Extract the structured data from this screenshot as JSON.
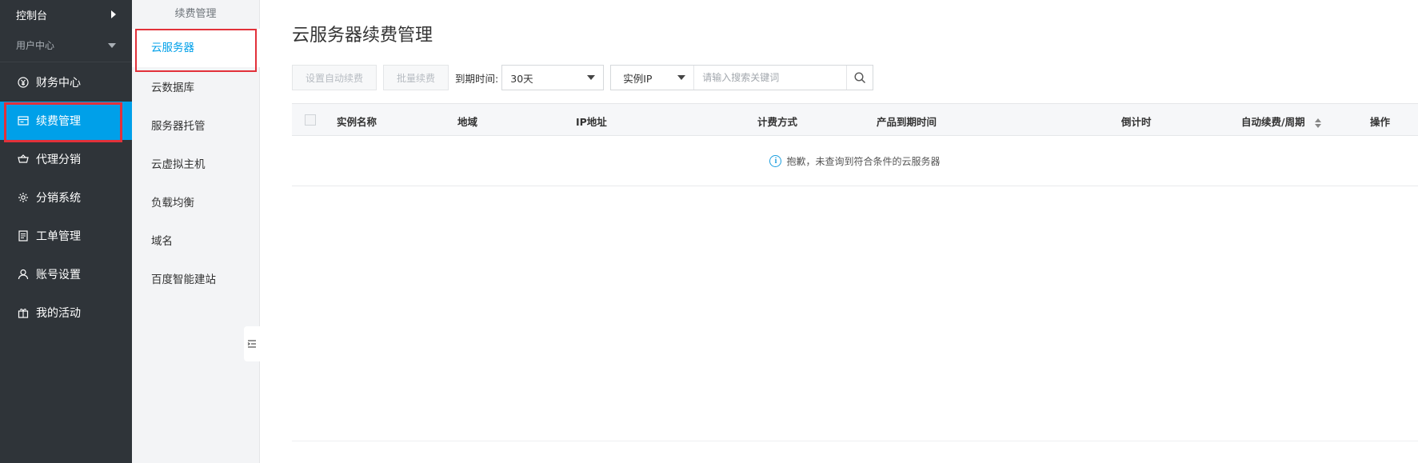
{
  "sidebar": {
    "console": "控制台",
    "user_center": "用户中心",
    "items": [
      {
        "label": "财务中心",
        "icon": "yen-coin-icon"
      },
      {
        "label": "续费管理",
        "icon": "renew-card-icon"
      },
      {
        "label": "代理分销",
        "icon": "basket-icon"
      },
      {
        "label": "分销系统",
        "icon": "gear-icon"
      },
      {
        "label": "工单管理",
        "icon": "document-icon"
      },
      {
        "label": "账号设置",
        "icon": "user-icon"
      },
      {
        "label": "我的活动",
        "icon": "gift-icon"
      }
    ]
  },
  "subpanel": {
    "title": "续费管理",
    "items": [
      {
        "label": "云服务器"
      },
      {
        "label": "云数据库"
      },
      {
        "label": "服务器托管"
      },
      {
        "label": "云虚拟主机"
      },
      {
        "label": "负载均衡"
      },
      {
        "label": "域名"
      },
      {
        "label": "百度智能建站"
      }
    ]
  },
  "main": {
    "title": "云服务器续费管理",
    "toolbar": {
      "auto_renew_btn": "设置自动续费",
      "batch_renew_btn": "批量续费",
      "expire_label": "到期时间:",
      "expire_value": "30天",
      "search_type": "实例IP",
      "search_placeholder": "请输入搜索关键词"
    },
    "table": {
      "columns": [
        "实例名称",
        "地域",
        "IP地址",
        "计费方式",
        "产品到期时间",
        "倒计时",
        "自动续费/周期",
        "操作"
      ],
      "empty_text": "抱歉，未查询到符合条件的云服务器"
    }
  },
  "colors": {
    "sidebar_bg": "#2f3439",
    "accent": "#00a0e9",
    "highlight_border": "#e2313a"
  }
}
